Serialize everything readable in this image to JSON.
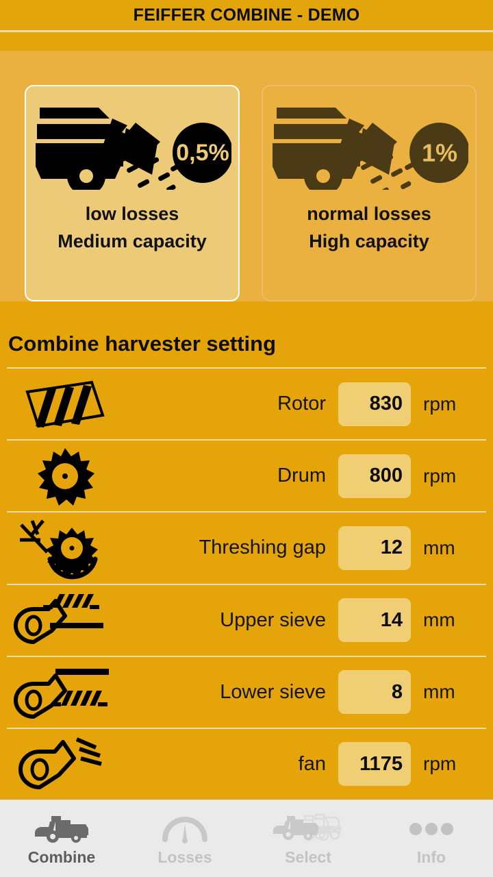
{
  "app": {
    "title": "FEIFFER COMBINE - DEMO"
  },
  "colors": {
    "title_bar": "#e2a50b",
    "title_rule": "#f0dca0",
    "mode_panel_bg": "#eab040",
    "card_selected_bg": "#ecca77",
    "card_selected_border": "#ffffff",
    "card_unselected_border": "#edbe65",
    "icon_selected": "#000000",
    "icon_unselected": "#4a3a16",
    "badge_label_selected": "#ecca77",
    "badge_label_unselected": "#e8bd62",
    "settings_bg": "#e5a50a",
    "separator": "#f1dda6",
    "value_box": "#efce74",
    "text_primary": "#0d0d0d",
    "navbar_bg": "#eaeaea",
    "nav_active": "#5d5d5d",
    "nav_inactive": "#c3c3c3"
  },
  "mode_cards": [
    {
      "id": "low-losses",
      "icon": "combine-grain-loss-icon",
      "badge_icon": "percent-badge-icon",
      "badge": "0,5%",
      "line1": "low losses",
      "line2": "Medium capacity",
      "selected": true
    },
    {
      "id": "normal-losses",
      "icon": "combine-grain-loss-icon",
      "badge_icon": "percent-badge-icon",
      "badge": "1%",
      "line1": "normal losses",
      "line2": "High capacity",
      "selected": false
    }
  ],
  "settings": {
    "heading": "Combine harvester setting",
    "rows": [
      {
        "icon": "rotor-icon",
        "label": "Rotor",
        "value": "830",
        "unit": "rpm"
      },
      {
        "icon": "drum-icon",
        "label": "Drum",
        "value": "800",
        "unit": "rpm"
      },
      {
        "icon": "threshing-gap-icon",
        "label": "Threshing gap",
        "value": "12",
        "unit": "mm"
      },
      {
        "icon": "upper-sieve-icon",
        "label": "Upper sieve",
        "value": "14",
        "unit": "mm"
      },
      {
        "icon": "lower-sieve-icon",
        "label": "Lower sieve",
        "value": "8",
        "unit": "mm"
      },
      {
        "icon": "fan-icon",
        "label": "fan",
        "value": "1175",
        "unit": "rpm"
      }
    ]
  },
  "navbar": {
    "items": [
      {
        "id": "combine",
        "icon": "combine-icon",
        "label": "Combine",
        "active": true
      },
      {
        "id": "losses",
        "icon": "gauge-icon",
        "label": "Losses",
        "active": false
      },
      {
        "id": "select",
        "icon": "multi-combine-icon",
        "label": "Select",
        "active": false
      },
      {
        "id": "info",
        "icon": "three-dots-icon",
        "label": "Info",
        "active": false
      }
    ]
  }
}
